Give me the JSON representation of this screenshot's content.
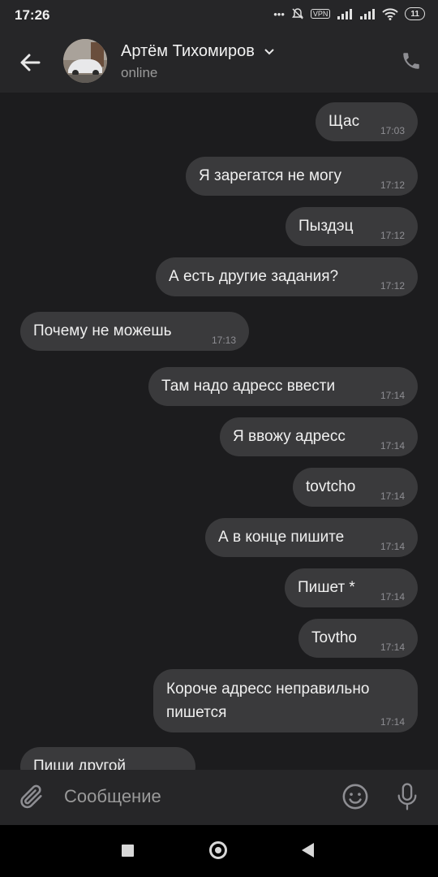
{
  "status_bar": {
    "time": "17:26",
    "vpn": "VPN",
    "battery": "11"
  },
  "header": {
    "contact_name": "Артём Тихомиров",
    "presence": "online"
  },
  "messages": [
    {
      "text": "Щас",
      "time": "17:03",
      "side": "out"
    },
    {
      "text": "Я зарегатся не могу",
      "time": "17:12",
      "side": "out"
    },
    {
      "text": "Пыздэц",
      "time": "17:12",
      "side": "out"
    },
    {
      "text": "А есть другие задания?",
      "time": "17:12",
      "side": "out"
    },
    {
      "text": "Почему не можешь",
      "time": "17:13",
      "side": "in"
    },
    {
      "text": "Там надо адресс ввести",
      "time": "17:14",
      "side": "out"
    },
    {
      "text": "Я ввожу адресс",
      "time": "17:14",
      "side": "out"
    },
    {
      "text": "tovtcho",
      "time": "17:14",
      "side": "out"
    },
    {
      "text": "А в конце пишите",
      "time": "17:14",
      "side": "out"
    },
    {
      "text": "Пишет *",
      "time": "17:14",
      "side": "out"
    },
    {
      "text": "Tovtho",
      "time": "17:14",
      "side": "out"
    },
    {
      "text": "Короче адресс неправильно\nпишется",
      "time": "17:14",
      "side": "out"
    },
    {
      "text": "Пиши другой",
      "time": "",
      "side": "in"
    }
  ],
  "composer": {
    "placeholder": "Сообщение"
  },
  "icons": {
    "back": "arrow-left-icon",
    "call": "phone-icon",
    "attach": "paperclip-icon",
    "emoji": "smile-icon",
    "voice": "microphone-icon",
    "nav_recents": "square-icon",
    "nav_home": "circle-icon",
    "nav_back": "triangle-icon"
  }
}
